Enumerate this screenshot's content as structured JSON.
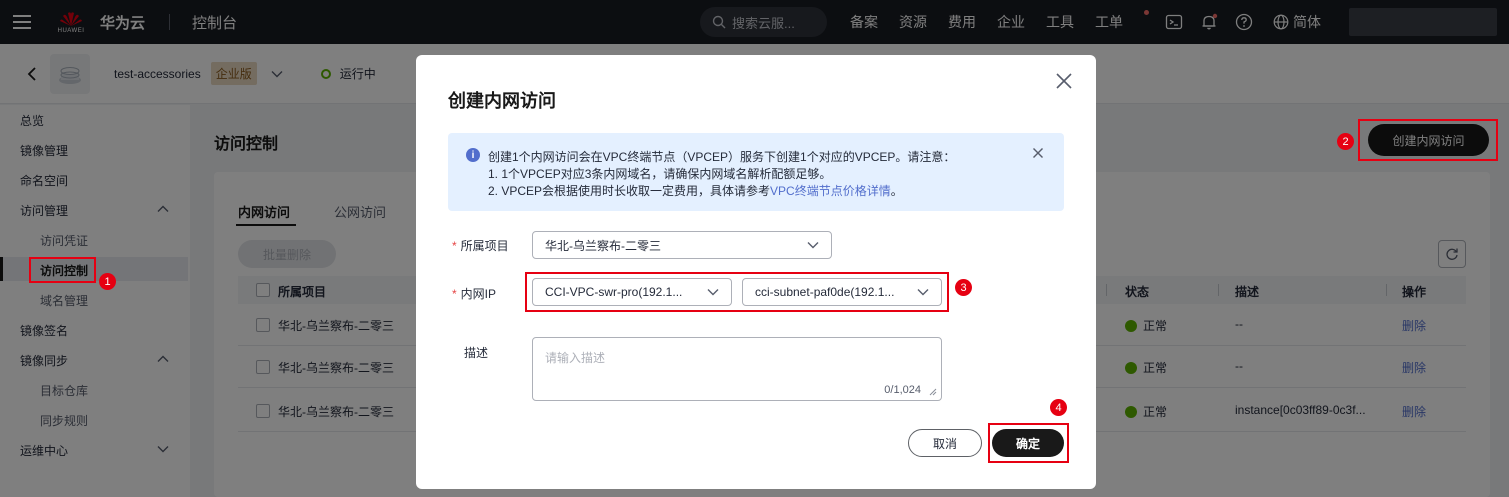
{
  "topbar": {
    "brand": "华为云",
    "logo_word": "HUAWEI",
    "console": "控制台",
    "search_placeholder": "搜索云服...",
    "links": [
      "备案",
      "资源",
      "费用",
      "企业",
      "工具",
      "工单"
    ],
    "language": "简体",
    "icons": [
      "menu-icon",
      "search-icon",
      "terminal-icon",
      "bell-icon",
      "help-icon",
      "globe-icon"
    ]
  },
  "instance": {
    "name": "test-accessories",
    "edition": "企业版",
    "status": "运行中"
  },
  "sidebar": {
    "items": [
      {
        "label": "总览"
      },
      {
        "label": "镜像管理"
      },
      {
        "label": "命名空间"
      },
      {
        "label": "访问管理"
      },
      {
        "label": "访问凭证"
      },
      {
        "label": "访问控制"
      },
      {
        "label": "域名管理"
      },
      {
        "label": "镜像签名"
      },
      {
        "label": "镜像同步"
      },
      {
        "label": "目标仓库"
      },
      {
        "label": "同步规则"
      },
      {
        "label": "运维中心"
      }
    ]
  },
  "main": {
    "title": "访问控制",
    "create_button": "创建内网访问",
    "tabs": [
      "内网访问",
      "公网访问"
    ],
    "batch_delete": "批量删除",
    "columns": [
      "所属项目",
      "状态",
      "描述",
      "操作"
    ],
    "rows": [
      {
        "project": "华北-乌兰察布-二零三",
        "status": "正常",
        "desc": "--",
        "action": "删除"
      },
      {
        "project": "华北-乌兰察布-二零三",
        "status": "正常",
        "desc": "--",
        "action": "删除"
      },
      {
        "project": "华北-乌兰察布-二零三",
        "status": "正常",
        "desc": "instance[0c03ff89-0c3f...",
        "action": "删除"
      }
    ]
  },
  "dialog": {
    "title": "创建内网访问",
    "notice": {
      "line1": "创建1个内网访问会在VPC终端节点（VPCEP）服务下创建1个对应的VPCEP。请注意：",
      "line2": "1. 1个VPCEP对应3条内网域名，请确保内网域名解析配额足够。",
      "line3_prefix": "2. VPCEP会根据使用时长收取一定费用，具体请参考",
      "line3_link": "VPC终端节点价格详情",
      "line3_suffix": "。"
    },
    "project_label": "所属项目",
    "project_value": "华北-乌兰察布-二零三",
    "ip_label": "内网IP",
    "vpc_value": "CCI-VPC-swr-pro(192.1...",
    "subnet_value": "cci-subnet-paf0de(192.1...",
    "desc_label": "描述",
    "desc_placeholder": "请输入描述",
    "desc_count": "0/1,024",
    "cancel": "取消",
    "confirm": "确定"
  },
  "annotations": {
    "steps": [
      "1",
      "2",
      "3",
      "4"
    ],
    "color": "#e60012"
  },
  "colors": {
    "topbar": "#191c22",
    "primary_button": "#191919",
    "success": "#5cb300",
    "link": "#526ecc",
    "required": "#e54545"
  }
}
